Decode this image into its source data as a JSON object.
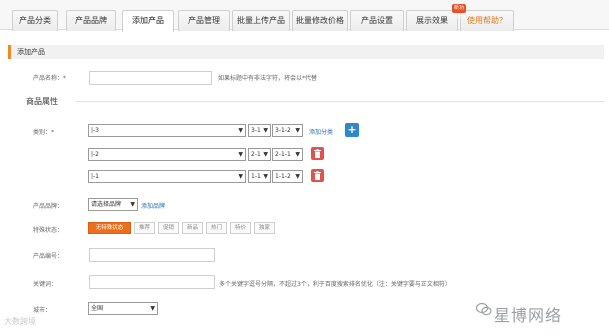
{
  "tabs": [
    {
      "label": "产品分类"
    },
    {
      "label": "产品品牌"
    },
    {
      "label": "添加产品",
      "active": true
    },
    {
      "label": "产品管理"
    },
    {
      "label": "批量上传产品"
    },
    {
      "label": "批量修改价格"
    },
    {
      "label": "产品设置"
    },
    {
      "label": "展示效果"
    },
    {
      "label": "使用帮助？"
    }
  ],
  "tab_badge": "新功能",
  "section_title": "添加产品",
  "product_name": {
    "label": "产品名称：*",
    "value": "",
    "hint": "如果标题中有非法字符，将会以*代替"
  },
  "attributes_title": "商品属性",
  "category": {
    "label": "类别：*",
    "rows": [
      {
        "main": "|-3",
        "sub1": "3-1",
        "sub2": "3-1-2"
      },
      {
        "main": "|-2",
        "sub1": "2-1",
        "sub2": "2-1-1"
      },
      {
        "main": "|-1",
        "sub1": "1-1",
        "sub2": "1-1-2"
      }
    ],
    "add_link": "添加分类"
  },
  "brand": {
    "label": "产品品牌：",
    "selected": "请选择品牌",
    "add_link": "添加品牌"
  },
  "special": {
    "label": "特殊状态：",
    "options": [
      "无特殊状态",
      "推荐",
      "促销",
      "新品",
      "热门",
      "特价",
      "独家"
    ],
    "selected_index": 0
  },
  "product_code": {
    "label": "产品编号：",
    "value": ""
  },
  "keywords": {
    "label": "关键词：",
    "value": "",
    "hint": "多个关键字逗号分隔，不超过3个，利于百度搜索排名优化（注：关键字要与正文相符）"
  },
  "city": {
    "label": "城市：",
    "selected": "全国"
  },
  "watermark_left": "大数跨境",
  "watermark_right": "星博网络",
  "colors": {
    "accent": "#f08a24",
    "active_tag": "#ec6f1f",
    "add_button": "#2f86c9",
    "delete_button": "#e0534d",
    "link": "#2a6fb3"
  }
}
